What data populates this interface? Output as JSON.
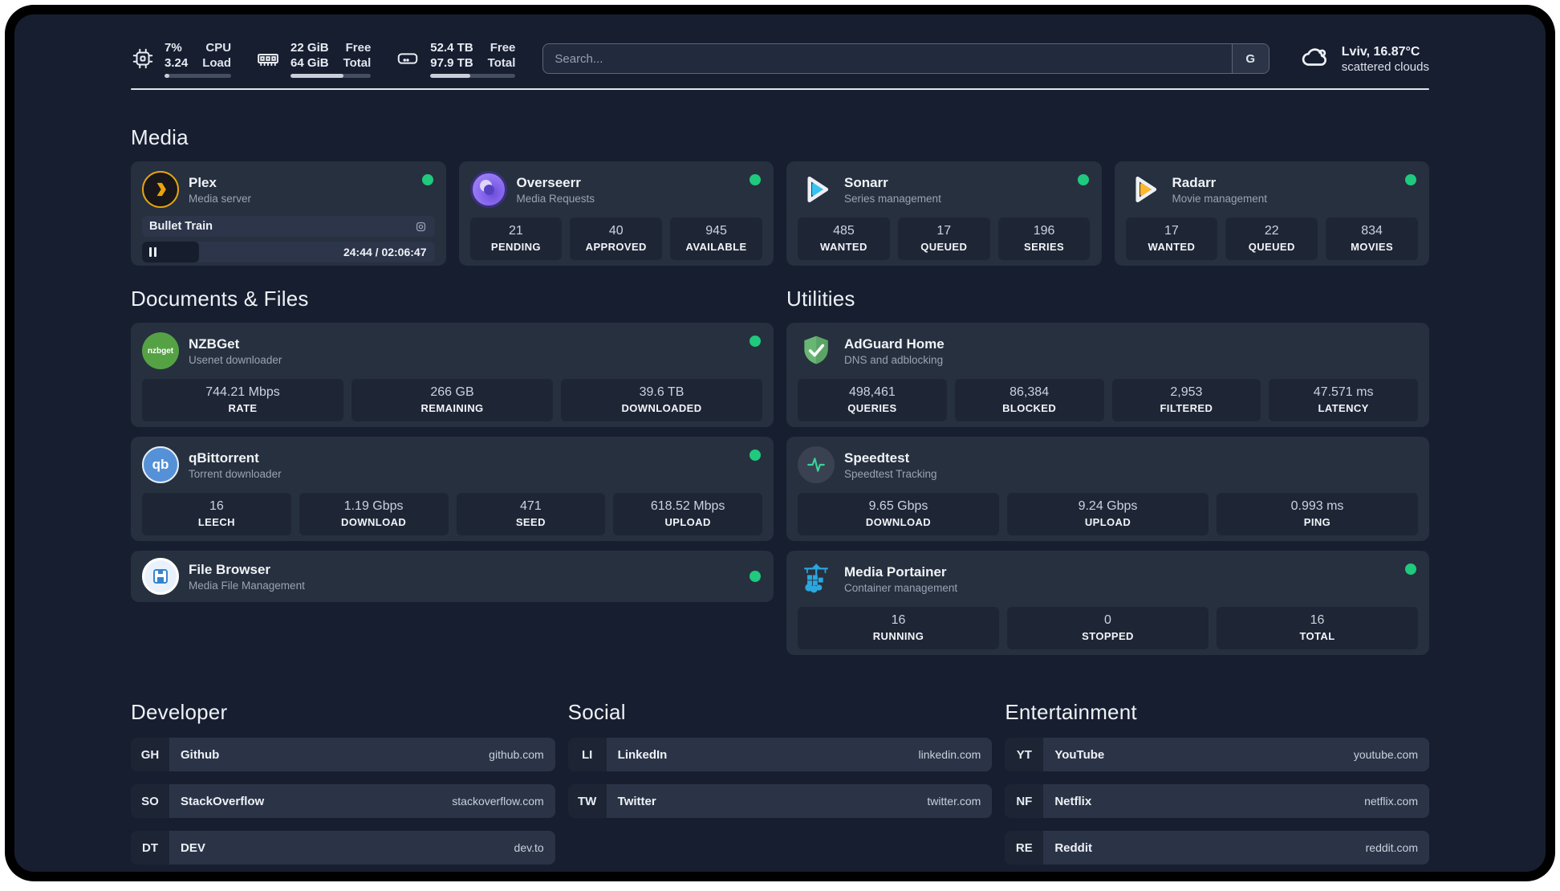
{
  "colors": {
    "background": "#171e30",
    "card": "#27303f",
    "tile": "#1e2636",
    "status_online": "#1fc97d",
    "divider": "#e2e6ec",
    "plex_gold": "#eba40a",
    "overseerr_purple": "#8b6cf0",
    "sonarr_cyan": "#38c3f1",
    "radarr_amber": "#ffb829",
    "nzbget_green": "#55a245",
    "qbittorrent_blue": "#5591d6",
    "filebrowser_blue": "#3584cf",
    "adguard_green": "#68b674",
    "speedtest_green": "#36d399",
    "portainer_blue": "#2aa7df"
  },
  "header": {
    "stats": [
      {
        "icon": "cpu-icon",
        "values": [
          "7%",
          "3.24"
        ],
        "labels": [
          "CPU",
          "Load"
        ],
        "progress": 7
      },
      {
        "icon": "memory-icon",
        "values": [
          "22 GiB",
          "64 GiB"
        ],
        "labels": [
          "Free",
          "Total"
        ],
        "progress": 66
      },
      {
        "icon": "disk-icon",
        "values": [
          "52.4 TB",
          "97.9 TB"
        ],
        "labels": [
          "Free",
          "Total"
        ],
        "progress": 47
      }
    ],
    "search": {
      "placeholder": "Search...",
      "engine": "G"
    },
    "weather": {
      "summary": "Lviv, 16.87°C",
      "condition": "scattered clouds"
    }
  },
  "sections": {
    "media": "Media",
    "documents": "Documents & Files",
    "utilities": "Utilities"
  },
  "apps": {
    "plex": {
      "name": "Plex",
      "desc": "Media server",
      "now_playing": {
        "title": "Bullet Train",
        "time": "24:44 / 02:06:47",
        "progress": 19.5
      }
    },
    "overseerr": {
      "name": "Overseerr",
      "desc": "Media Requests",
      "stats": [
        {
          "value": "21",
          "label": "PENDING"
        },
        {
          "value": "40",
          "label": "APPROVED"
        },
        {
          "value": "945",
          "label": "AVAILABLE"
        }
      ]
    },
    "sonarr": {
      "name": "Sonarr",
      "desc": "Series management",
      "stats": [
        {
          "value": "485",
          "label": "WANTED"
        },
        {
          "value": "17",
          "label": "QUEUED"
        },
        {
          "value": "196",
          "label": "SERIES"
        }
      ]
    },
    "radarr": {
      "name": "Radarr",
      "desc": "Movie management",
      "stats": [
        {
          "value": "17",
          "label": "WANTED"
        },
        {
          "value": "22",
          "label": "QUEUED"
        },
        {
          "value": "834",
          "label": "MOVIES"
        }
      ]
    },
    "nzbget": {
      "name": "NZBGet",
      "desc": "Usenet downloader",
      "logo_text": "nzbget",
      "stats": [
        {
          "value": "744.21 Mbps",
          "label": "RATE"
        },
        {
          "value": "266 GB",
          "label": "REMAINING"
        },
        {
          "value": "39.6 TB",
          "label": "DOWNLOADED"
        }
      ]
    },
    "qbittorrent": {
      "name": "qBittorrent",
      "desc": "Torrent downloader",
      "logo_text": "qb",
      "stats": [
        {
          "value": "16",
          "label": "LEECH"
        },
        {
          "value": "1.19 Gbps",
          "label": "DOWNLOAD"
        },
        {
          "value": "471",
          "label": "SEED"
        },
        {
          "value": "618.52 Mbps",
          "label": "UPLOAD"
        }
      ]
    },
    "filebrowser": {
      "name": "File Browser",
      "desc": "Media File Management"
    },
    "adguard": {
      "name": "AdGuard Home",
      "desc": "DNS and adblocking",
      "stats": [
        {
          "value": "498,461",
          "label": "QUERIES"
        },
        {
          "value": "86,384",
          "label": "BLOCKED"
        },
        {
          "value": "2,953",
          "label": "FILTERED"
        },
        {
          "value": "47.571 ms",
          "label": "LATENCY"
        }
      ]
    },
    "speedtest": {
      "name": "Speedtest",
      "desc": "Speedtest Tracking",
      "stats": [
        {
          "value": "9.65 Gbps",
          "label": "DOWNLOAD"
        },
        {
          "value": "9.24 Gbps",
          "label": "UPLOAD"
        },
        {
          "value": "0.993 ms",
          "label": "PING"
        }
      ]
    },
    "portainer": {
      "name": "Media Portainer",
      "desc": "Container management",
      "stats": [
        {
          "value": "16",
          "label": "RUNNING"
        },
        {
          "value": "0",
          "label": "STOPPED"
        },
        {
          "value": "16",
          "label": "TOTAL"
        }
      ]
    }
  },
  "bookmarks": {
    "groups": [
      {
        "title": "Developer",
        "links": [
          {
            "abbr": "GH",
            "name": "Github",
            "url": "github.com"
          },
          {
            "abbr": "SO",
            "name": "StackOverflow",
            "url": "stackoverflow.com"
          },
          {
            "abbr": "DT",
            "name": "DEV",
            "url": "dev.to"
          }
        ]
      },
      {
        "title": "Social",
        "links": [
          {
            "abbr": "LI",
            "name": "LinkedIn",
            "url": "linkedin.com"
          },
          {
            "abbr": "TW",
            "name": "Twitter",
            "url": "twitter.com"
          }
        ]
      },
      {
        "title": "Entertainment",
        "links": [
          {
            "abbr": "YT",
            "name": "YouTube",
            "url": "youtube.com"
          },
          {
            "abbr": "NF",
            "name": "Netflix",
            "url": "netflix.com"
          },
          {
            "abbr": "RE",
            "name": "Reddit",
            "url": "reddit.com"
          }
        ]
      }
    ]
  }
}
